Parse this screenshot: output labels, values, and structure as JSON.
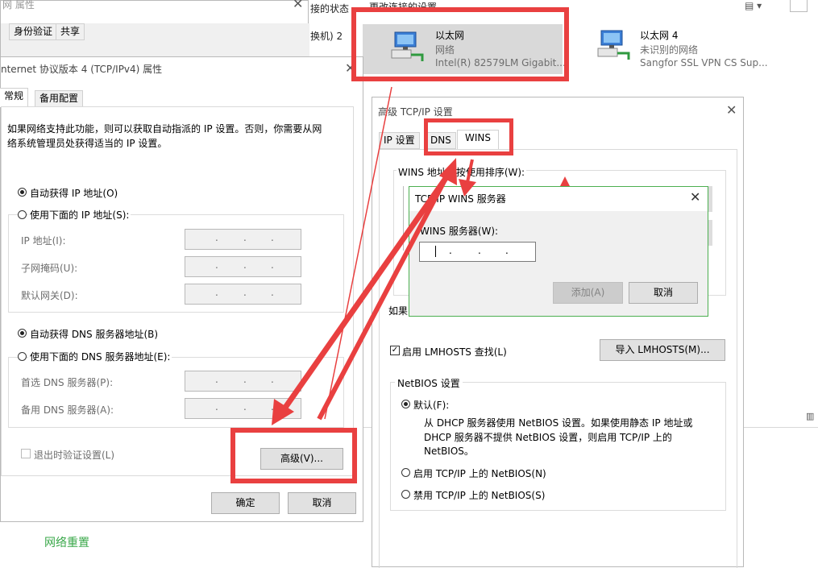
{
  "bg": {
    "status_text": "接的状态",
    "change_text": "更改连接的设置",
    "left_frag": "换机) 2",
    "network_reset": "网络重置",
    "view_icon": "view-options-icon"
  },
  "adapters": [
    {
      "name": "以太网",
      "status": "网络",
      "device": "Intel(R) 82579LM Gigabit..."
    },
    {
      "name": "以太网 4",
      "status": "未识别的网络",
      "device": "Sangfor SSL VPN CS Sup..."
    }
  ],
  "props_dialog": {
    "title": "网 属性",
    "tabs": [
      "身份验证",
      "共享"
    ]
  },
  "ipv4": {
    "title": "nternet 协议版本 4 (TCP/IPv4) 属性",
    "tabs": [
      "常规",
      "备用配置"
    ],
    "desc_line1": "如果网络支持此功能，则可以获取自动指派的 IP 设置。否则，你需要从网",
    "desc_line2": "络系统管理员处获得适当的 IP 设置。",
    "auto_ip": "自动获得 IP 地址(O)",
    "manual_ip": "使用下面的 IP 地址(S):",
    "ip_label": "IP 地址(I):",
    "mask_label": "子网掩码(U):",
    "gateway_label": "默认网关(D):",
    "auto_dns": "自动获得 DNS 服务器地址(B)",
    "manual_dns": "使用下面的 DNS 服务器地址(E):",
    "pref_dns": "首选 DNS 服务器(P):",
    "alt_dns": "备用 DNS 服务器(A):",
    "validate": "退出时验证设置(L)",
    "advanced": "高级(V)...",
    "ok": "确定",
    "cancel": "取消"
  },
  "advanced": {
    "title": "高级 TCP/IP 设置",
    "tabs": [
      "IP 设置",
      "DNS",
      "WINS"
    ],
    "wins_list_label": "WINS 地址，按使用排序(W):",
    "frag_if": "如果",
    "lmhosts": "启用 LMHOSTS 查找(L)",
    "import_lmhosts": "导入 LMHOSTS(M)...",
    "netbios_group": "NetBIOS 设置",
    "default": "默认(F):",
    "default_desc1": "从 DHCP 服务器使用 NetBIOS 设置。如果使用静态 IP 地址或",
    "default_desc2": "DHCP 服务器不提供 NetBIOS 设置，则启用 TCP/IP 上的",
    "default_desc3": "NetBIOS。",
    "enable_netbios": "启用 TCP/IP 上的 NetBIOS(N)",
    "disable_netbios": "禁用 TCP/IP 上的 NetBIOS(S)"
  },
  "wins_dialog": {
    "title": "TCP/IP WINS 服务器",
    "label": "WINS 服务器(W):",
    "add": "添加(A)",
    "cancel": "取消"
  },
  "colors": {
    "annotation_red": "#e94040",
    "accent_green": "#3aa84a",
    "wins_border": "#4caf50"
  }
}
